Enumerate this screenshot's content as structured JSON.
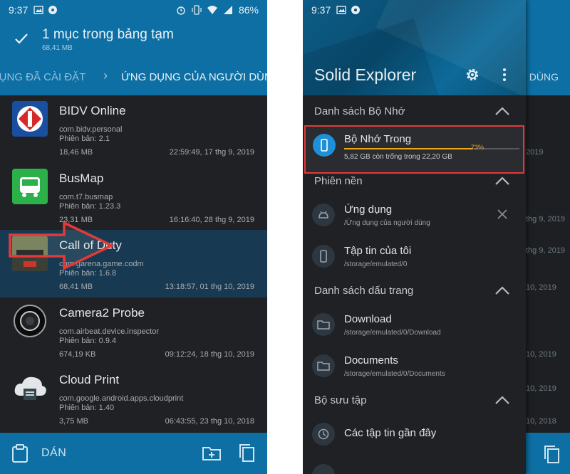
{
  "left": {
    "status": {
      "time": "9:37",
      "battery": "86%"
    },
    "clipboard": {
      "title": "1 mục trong bảng tạm",
      "size": "68,41 MB"
    },
    "breadcrumb": {
      "prev": "G DỤNG ĐÃ CÀI ĐẶT",
      "current": "ỨNG DỤNG CỦA NGƯỜI DÙNG"
    },
    "apps": [
      {
        "name": "BIDV Online",
        "package": "com.bidv.personal",
        "version": "Phiên bản: 2.1",
        "size": "18,46 MB",
        "date": "22:59:49, 17 thg 9, 2019",
        "icon": "bidv-icon"
      },
      {
        "name": "BusMap",
        "package": "com.t7.busmap",
        "version": "Phiên bản: 1.23.3",
        "size": "23,31 MB",
        "date": "16:16:40, 28 thg 9, 2019",
        "icon": "busmap-icon"
      },
      {
        "name": "Call of Duty",
        "package": "com.garena.game.codm",
        "version": "Phiên bản: 1.6.8",
        "size": "68,41 MB",
        "date": "13:18:57, 01 thg 10, 2019",
        "icon": "call-of-duty-icon"
      },
      {
        "name": "Camera2 Probe",
        "package": "com.airbeat.device.inspector",
        "version": "Phiên bản: 0.9.4",
        "size": "674,19 KB",
        "date": "09:12:24, 18 thg 10, 2019",
        "icon": "camera-lens-icon"
      },
      {
        "name": "Cloud Print",
        "package": "com.google.android.apps.cloudprint",
        "version": "Phiên bản: 1.40",
        "size": "3,75 MB",
        "date": "06:43:55, 23 thg 10, 2018",
        "icon": "cloud-print-icon"
      }
    ],
    "bottom": {
      "paste_label": "DÁN"
    }
  },
  "right": {
    "status": {
      "time": "9:37",
      "battery": "86%"
    },
    "behind": {
      "tab_fragment": "I DÙNG",
      "dates": [
        "2019",
        "thg 9, 2019",
        "thg 9, 2019",
        "10, 2019",
        "10, 2019",
        "10, 2019",
        "10, 2018"
      ]
    },
    "drawer": {
      "app_title": "Solid Explorer",
      "sections": {
        "storage": "Danh sách Bộ Nhớ",
        "sessions": "Phiên nền",
        "bookmarks": "Danh sách dấu trang",
        "collections": "Bộ sưu tập"
      },
      "internal_storage": {
        "title": "Bộ Nhớ Trong",
        "percent_label": "73%",
        "used_fraction": 0.73,
        "detail": "5,82 GB còn trống trong 22,20 GB"
      },
      "sessions": [
        {
          "title": "Ứng dụng",
          "path": "/Ứng dụng của người dùng"
        },
        {
          "title": "Tập tin của tôi",
          "path": "/storage/emulated/0"
        }
      ],
      "bookmarks": [
        {
          "title": "Download",
          "path": "/storage/emulated/0/Download"
        },
        {
          "title": "Documents",
          "path": "/storage/emulated/0/Documents"
        }
      ],
      "collections": [
        {
          "title": "Các tập tin gần đây"
        }
      ]
    }
  },
  "colors": {
    "accent": "#0d6fa3",
    "progress": "#f0a81a",
    "highlight": "#e53939",
    "storage_icon": "#1e8fd8"
  }
}
